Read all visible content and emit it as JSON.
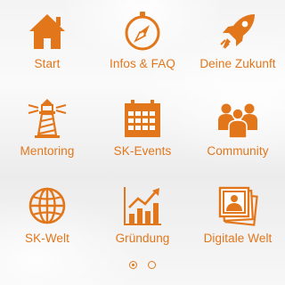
{
  "theme": {
    "accent": "#e2761b"
  },
  "tiles": [
    {
      "label": "Start",
      "icon": "home-icon"
    },
    {
      "label": "Infos & FAQ",
      "icon": "compass-icon"
    },
    {
      "label": "Deine Zukunft",
      "icon": "rocket-icon"
    },
    {
      "label": "Mentoring",
      "icon": "lighthouse-icon"
    },
    {
      "label": "SK-Events",
      "icon": "calendar-icon"
    },
    {
      "label": "Community",
      "icon": "people-icon"
    },
    {
      "label": "SK-Welt",
      "icon": "globe-icon"
    },
    {
      "label": "Gründung",
      "icon": "growth-chart-icon"
    },
    {
      "label": "Digitale Welt",
      "icon": "photo-gallery-icon"
    }
  ],
  "pagination": {
    "pages": 2,
    "current": 1
  }
}
